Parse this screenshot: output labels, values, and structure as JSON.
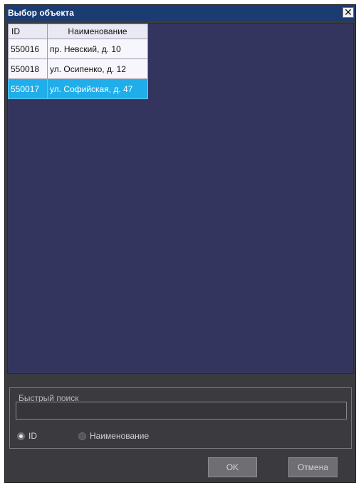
{
  "window": {
    "title": "Выбор объекта",
    "close_glyph": "✕"
  },
  "table": {
    "columns": [
      "ID",
      "Наименование"
    ],
    "rows": [
      {
        "id": "550016",
        "name": "пр. Невский, д. 10",
        "selected": false
      },
      {
        "id": "550018",
        "name": "ул. Осипенко, д. 12",
        "selected": false
      },
      {
        "id": "550017",
        "name": "ул. Софийская, д. 47",
        "selected": true
      }
    ]
  },
  "search": {
    "group_title": "Быстрый поиск",
    "input_value": "",
    "options": [
      {
        "label": "ID",
        "checked": true
      },
      {
        "label": "Наименование",
        "checked": false
      }
    ]
  },
  "buttons": {
    "ok": "OK",
    "cancel": "Отмена"
  },
  "colors": {
    "titlebar": "#1b3b73",
    "list_bg": "#34355f",
    "selection": "#1faeea",
    "panel_bg": "#3a3a3f"
  },
  "icons": {
    "close": "close-icon",
    "radio_on": "radio-checked-icon",
    "radio_off": "radio-unchecked-icon"
  }
}
